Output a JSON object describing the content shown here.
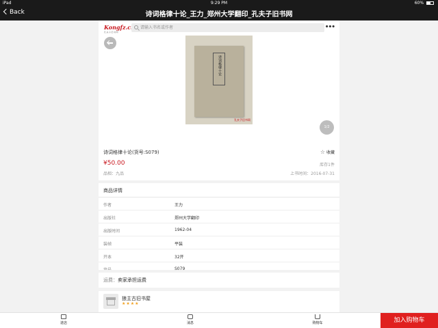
{
  "status_bar": {
    "device": "iPad",
    "time": "9:29 PM",
    "battery": "60%"
  },
  "nav": {
    "back_label": "Back",
    "title": "诗词格律十论_王力_郑州大学翻印_孔夫子旧书网"
  },
  "header": {
    "logo_text": "Kongfz.cn",
    "logo_sub": "孔夫子旧书网",
    "search_placeholder": "请输入书名或作者"
  },
  "gallery": {
    "pager": "1/2",
    "cover_text": "诗词格律十论",
    "watermark": "孔夫子旧书网"
  },
  "book": {
    "title": "诗词格律十论(货号:S079)",
    "favorite_label": "收藏",
    "price": "¥50.00",
    "stock": "库存1件",
    "condition": "品相：九品",
    "listed": "上书时间：2016-07-31"
  },
  "details": {
    "heading": "商品详情",
    "rows": [
      {
        "key": "作者",
        "value": "王力"
      },
      {
        "key": "出版社",
        "value": "郑州大学翻印"
      },
      {
        "key": "出版时间",
        "value": "1962-04"
      },
      {
        "key": "装帧",
        "value": "平装"
      },
      {
        "key": "开本",
        "value": "32开"
      },
      {
        "key": "货号",
        "value": "S079"
      },
      {
        "key": "商品描述",
        "value": ""
      }
    ]
  },
  "shipping": {
    "label": "运费：",
    "value": "卖家承担运费"
  },
  "shop": {
    "name": "狼主古旧书屋",
    "rating": "★★★★"
  },
  "toolbar": {
    "store_label": "进店",
    "chat_label": "消息",
    "cart_label": "购物车",
    "add_to_cart": "加入购物车"
  }
}
